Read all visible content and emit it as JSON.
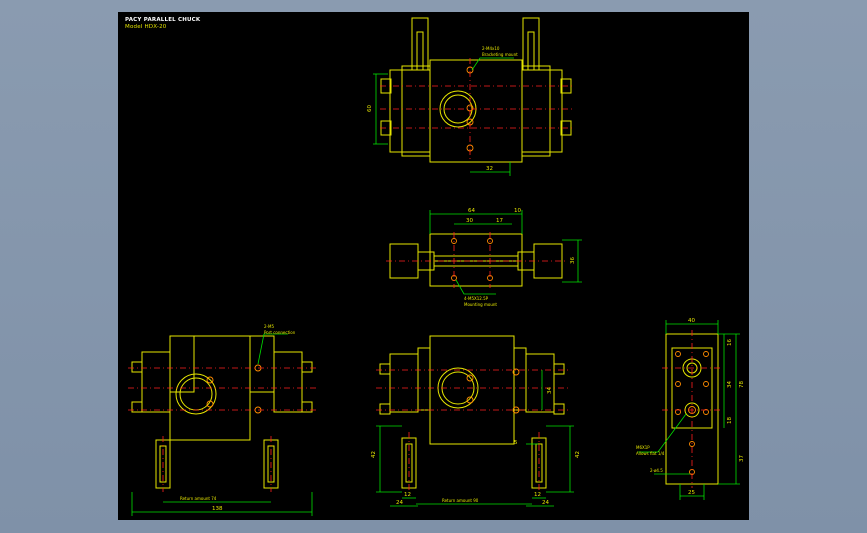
{
  "title": {
    "line1": "PACY PARALLEL CHUCK",
    "line2": "Model  HDX-20"
  },
  "colors": {
    "background": "#000000",
    "outline": "#e6e600",
    "dimension": "#00e000",
    "centerline": "#ff2020",
    "hole": "#ff8c00"
  },
  "top_view": {
    "note1": "2-M4x10",
    "note2": "Bracketing mount",
    "dim_height": "60",
    "dim_width": "32"
  },
  "middle_view": {
    "dim_64": "64",
    "dim_10": "10",
    "dim_30": "30",
    "dim_17": "17",
    "dim_36": "36",
    "note1": "4-M5X12.5P",
    "note2": "Mounting mount"
  },
  "left_view": {
    "note1": "2-M5",
    "note2": "Port connection",
    "stroke_label": "Return amount  74",
    "dim_138": "138"
  },
  "center_view": {
    "dim_42_left": "42",
    "dim_42_right": "42",
    "dim_34": "34",
    "dim_5": "5",
    "dim_12_left": "12",
    "dim_12_right": "12",
    "dim_24_left": "24",
    "dim_24_right": "24",
    "stroke_label": "Return amount  90"
  },
  "side_view": {
    "dim_40": "40",
    "dim_16_top": "16",
    "dim_18_bottom": "18",
    "dim_34": "34",
    "dim_78": "78",
    "dim_37": "37",
    "dim_25": "25",
    "note1": "M6X1P",
    "note2": "Allows flat 1/4",
    "note3": "2-ø4.5"
  }
}
